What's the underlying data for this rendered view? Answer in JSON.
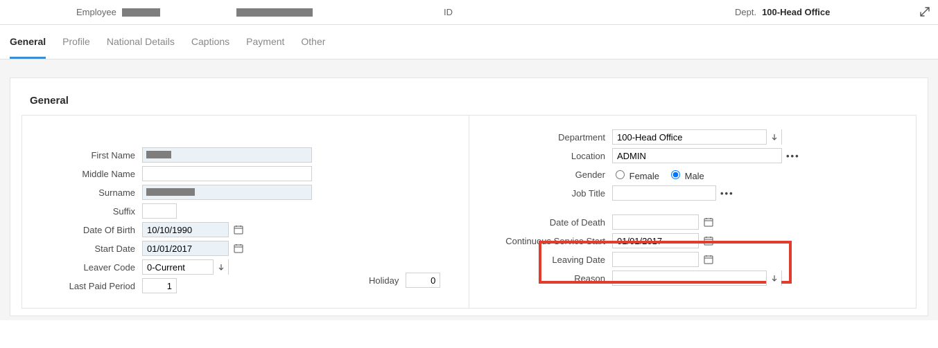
{
  "header": {
    "employee_label": "Employee",
    "id_label": "ID",
    "dept_label": "Dept.",
    "dept_value": "100-Head Office"
  },
  "tabs": {
    "items": [
      "General",
      "Profile",
      "National Details",
      "Captions",
      "Payment",
      "Other"
    ]
  },
  "section_title": "General",
  "left": {
    "first_name_label": "First Name",
    "middle_name_label": "Middle Name",
    "surname_label": "Surname",
    "suffix_label": "Suffix",
    "dob_label": "Date Of Birth",
    "dob_value": "10/10/1990",
    "start_date_label": "Start Date",
    "start_date_value": "01/01/2017",
    "leaver_code_label": "Leaver Code",
    "leaver_code_value": "0-Current",
    "last_paid_period_label": "Last Paid Period",
    "last_paid_period_value": "1",
    "holiday_label": "Holiday",
    "holiday_value": "0"
  },
  "right": {
    "department_label": "Department",
    "department_value": "100-Head Office",
    "location_label": "Location",
    "location_value": "ADMIN",
    "gender_label": "Gender",
    "gender_female_label": "Female",
    "gender_male_label": "Male",
    "gender_value": "Male",
    "job_title_label": "Job Title",
    "job_title_value": "",
    "date_of_death_label": "Date of Death",
    "date_of_death_value": "",
    "css_label": "Continuous Service Start",
    "css_value": "01/01/2017",
    "leaving_date_label": "Leaving Date",
    "leaving_date_value": "",
    "reason_label": "Reason",
    "reason_value": ""
  }
}
